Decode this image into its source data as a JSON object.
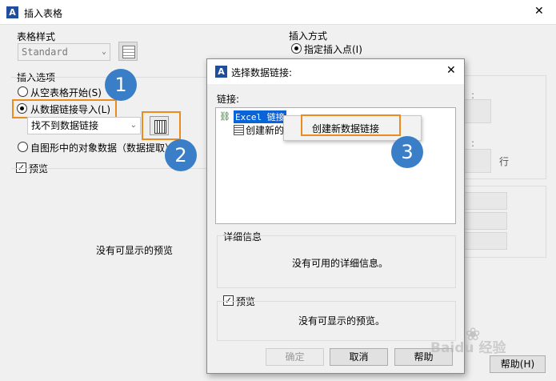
{
  "main": {
    "title": "插入表格",
    "close_glyph": "✕",
    "table_style_label": "表格样式",
    "table_style_value": "Standard",
    "insert_options_label": "插入选项",
    "radio_empty": "从空表格开始(S)",
    "radio_datalink": "从数据链接导入(L)",
    "datalink_combo": "找不到数据链接",
    "radio_drawing": "自图形中的对象数据（数据提取）(X)",
    "preview_check_label": "预览",
    "preview_text": "没有可显示的预览",
    "insert_method_label": "插入方式",
    "radio_insert_point": "指定插入点(I)",
    "row_suffix": "行",
    "help_button": "帮助(H)"
  },
  "dialog": {
    "title": "选择数据链接:",
    "close_glyph": "✕",
    "links_label": "链接:",
    "tree_item_excel": "Excel 链接",
    "tree_item_create": "创建新的",
    "context_menu_item": "创建新数据链接",
    "details_label": "详细信息",
    "details_text": "没有可用的详细信息。",
    "preview_label": "预览",
    "preview_text": "没有可显示的预览。",
    "ok_button": "确定",
    "cancel_button": "取消",
    "help_button": "帮助"
  },
  "annotations": {
    "step1": "1",
    "step2": "2",
    "step3": "3",
    "highlight_color": "#ea8d1e",
    "badge_color": "#3a7ec8"
  },
  "watermark": {
    "text": "Baidu 经验"
  }
}
